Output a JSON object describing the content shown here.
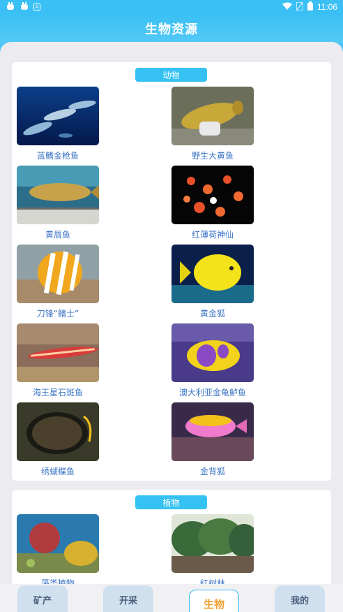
{
  "status": {
    "left_icons": [
      "bug-icon",
      "bug-icon",
      "a-icon"
    ],
    "time": "11:06"
  },
  "header": {
    "title": "生物资源"
  },
  "sections": [
    {
      "tag": "动物",
      "items": [
        {
          "label": "蓝鳍金枪鱼",
          "image": "bluefin-tuna-image"
        },
        {
          "label": "野生大黄鱼",
          "image": "yellow-croaker-image"
        },
        {
          "label": "黄唇鱼",
          "image": "yellow-lip-fish-image"
        },
        {
          "label": "红薄荷神仙",
          "image": "peppermint-angelfish-image"
        },
        {
          "label": "刀锋“鳍士”",
          "image": "butterflyfish-image"
        },
        {
          "label": "黄金狐",
          "image": "yellow-tang-image"
        },
        {
          "label": "海王星石斑鱼",
          "image": "neptune-grouper-image"
        },
        {
          "label": "澳大利亚金龟鲈鱼",
          "image": "australian-fish-image"
        },
        {
          "label": "绣蝴蝶鱼",
          "image": "embroidered-butterflyfish-image"
        },
        {
          "label": "金背狐",
          "image": "golden-back-fish-image"
        }
      ]
    },
    {
      "tag": "植物",
      "items": [
        {
          "label": "藻类植物",
          "image": "coral-algae-image"
        },
        {
          "label": "红树林",
          "image": "mangrove-image"
        }
      ]
    }
  ],
  "nav": {
    "tabs": [
      {
        "label": "矿产",
        "active": false
      },
      {
        "label": "开采",
        "active": false
      },
      {
        "label": "生物",
        "active": true
      },
      {
        "label": "我的",
        "active": false
      }
    ]
  },
  "colors": {
    "primary": "#35c2f3",
    "label": "#3b74c6",
    "active_tab_text": "#f0a030"
  }
}
